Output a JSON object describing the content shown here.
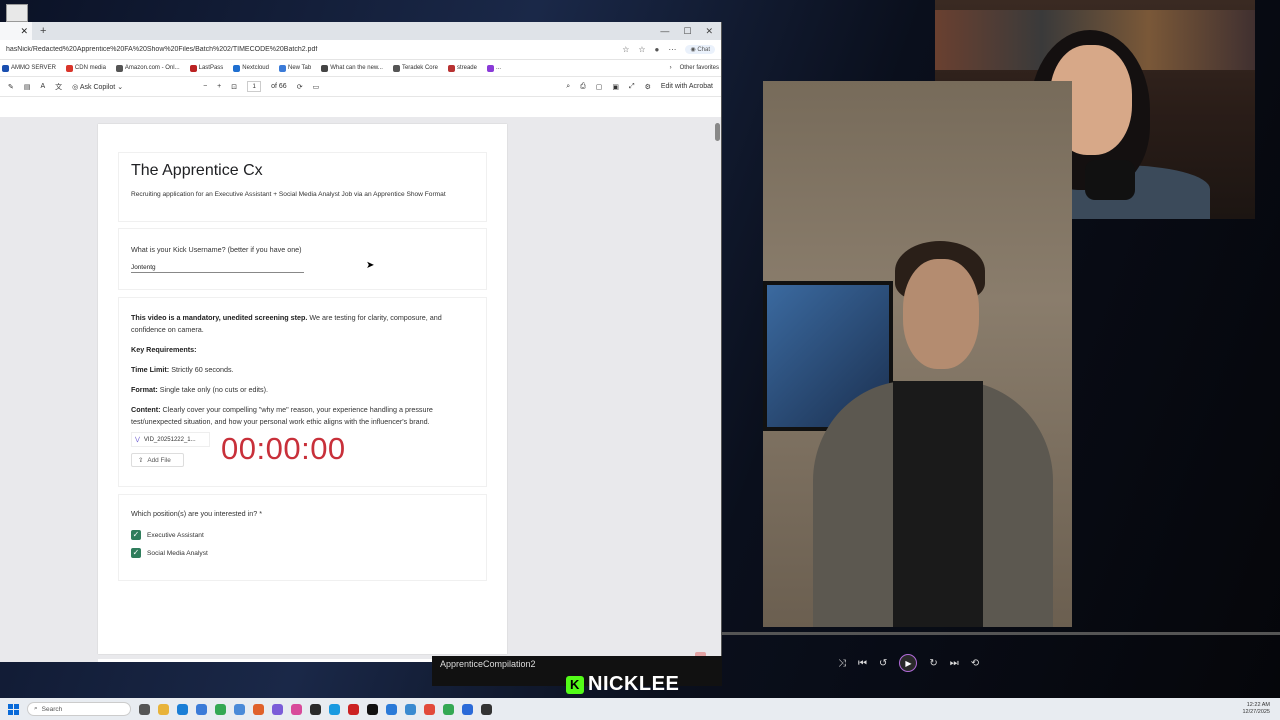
{
  "browser": {
    "url": "hasNick/Redacted%20Apprentice%20FA%20Show%20Files/Batch%202/TIMECODE%20Batch2.pdf",
    "chat_label": "Chat",
    "win_min": "—",
    "win_max": "☐",
    "win_close": "✕",
    "tab_close": "✕",
    "new_tab": "+",
    "bookmarks": [
      "AMMO SERVER",
      "CDN media",
      "Amazon.com - Onl...",
      "LastPass",
      "Nextcloud",
      "New Tab",
      "What can the new...",
      "Teradek Core",
      "streade",
      "..."
    ],
    "bookmark_colors": [
      "#1a4fb0",
      "#d9352b",
      "#555555",
      "#bb2222",
      "#1f6fd0",
      "#3b7bd8",
      "#444444",
      "#555555",
      "#b83232",
      "#8a3ad8"
    ],
    "other_favorites": "Other favorites",
    "pdf": {
      "ask_copilot": "Ask Copilot",
      "page_num": "1",
      "page_total": "of 66",
      "edit_label": "Edit with Acrobat"
    }
  },
  "form": {
    "title": "The Apprentice Cx",
    "description": "Recruiting application for an Executive Assistant + Social Media Analyst Job via an Apprentice Show Format",
    "kick_question": "What is your Kick Username? (better if you have one)",
    "kick_answer": "Jontentg",
    "video_intro_bold": "This video is a mandatory, unedited screening step.",
    "video_intro_rest": " We are testing for clarity, composure, and confidence on camera.",
    "key_req": "Key Requirements:",
    "time_label": "Time Limit:",
    "time_value": " Strictly 60 seconds.",
    "format_label": "Format:",
    "format_value": " Single take only (no cuts or edits).",
    "content_label": "Content:",
    "content_value": " Clearly cover your compelling \"why me\" reason, your experience handling a pressure test/unexpected situation, and how your personal work ethic aligns with the influencer's brand.",
    "file_name": "VID_20251222_1...",
    "add_file": "Add File",
    "timer": "00:00:00",
    "position_question": "Which position(s) are you interested in? *",
    "positions": [
      "Executive Assistant",
      "Social Media Analyst"
    ]
  },
  "player": {
    "file_title": "ApprenticeCompilation2"
  },
  "brand": {
    "letter": "K",
    "name": "NICKLEE"
  },
  "taskbar": {
    "search_placeholder": "Search",
    "time": "12:22 AM",
    "date": "12/27/2025"
  },
  "colors": {
    "timer": "#c8303a",
    "checkbox": "#2f7d5c",
    "kick_green": "#53fc18"
  }
}
